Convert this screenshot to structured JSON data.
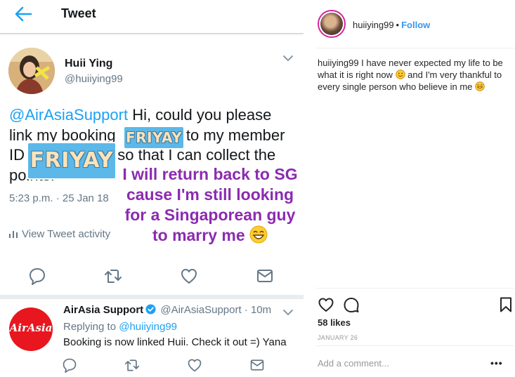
{
  "twitter": {
    "header": {
      "title": "Tweet"
    },
    "tweet": {
      "name": "Huii Ying",
      "handle": "@huiiying99",
      "mention": "@AirAsiaSupport",
      "text_1": " Hi, could you please",
      "text_2": "link my booking ",
      "text_3": " to my member",
      "text_4": "ID ",
      "text_5": " so that I can collect the",
      "text_6": "points.",
      "timestamp": "5:23 p.m. · 25 Jan 18",
      "activity_label": "View Tweet activity"
    },
    "stickers": {
      "small": "FRIYAY",
      "big": "FRIYAY"
    },
    "overlay_text": {
      "line1": "I will return back to SG",
      "line2": "cause I'm still looking",
      "line3": "for a Singaporean guy",
      "line4": "to marry me"
    },
    "reply": {
      "avatar_text": "AirAsia",
      "name": "AirAsia Support",
      "handle_time": "@AirAsiaSupport · 10m",
      "replying_prefix": "Replying to ",
      "replying_handle": "@huiiying99",
      "text": "Booking is now linked Huii. Check it out =) Yana"
    },
    "colors": {
      "link": "#1da1f2",
      "overlay": "#8b2bb0",
      "airasia": "#e8161e"
    },
    "icons": [
      "back-arrow-icon",
      "chevron-down-icon",
      "reply-icon",
      "retweet-icon",
      "like-icon",
      "dm-icon",
      "verified-icon",
      "analytics-icon"
    ]
  },
  "instagram": {
    "username": "huiiying99",
    "dot": "•",
    "follow_label": "Follow",
    "caption_user": "huiiying99",
    "caption_1": " I have never expected my life to be what it is right now ",
    "caption_2": " and I'm very thankful to every single person who believe in me ",
    "likes": "58 likes",
    "date": "JANUARY 26",
    "comment_placeholder": "Add a comment...",
    "more": "•••",
    "colors": {
      "follow": "#3897f0",
      "text": "#262626"
    },
    "icons": [
      "heart-icon",
      "comment-icon",
      "bookmark-icon",
      "smile-emoji-icon"
    ]
  }
}
